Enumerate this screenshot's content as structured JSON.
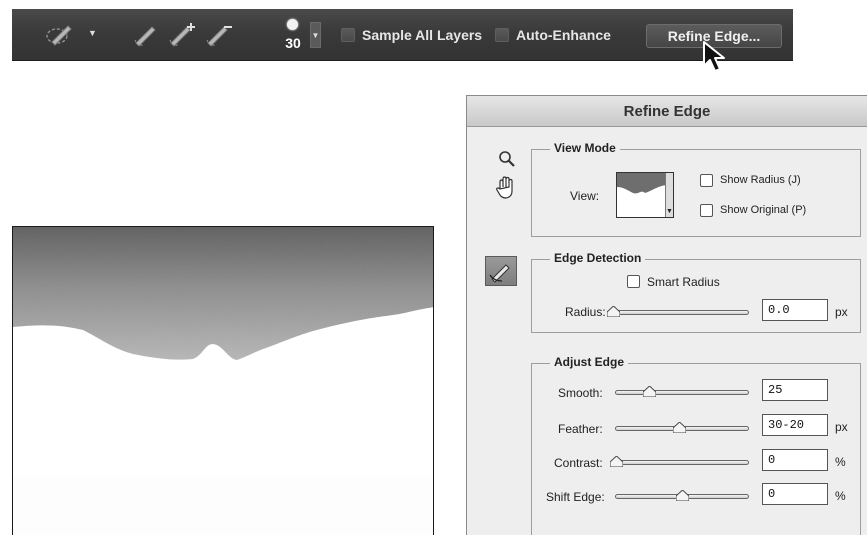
{
  "options_bar": {
    "brush_size": "30",
    "sample_all_layers_label": "Sample All Layers",
    "auto_enhance_label": "Auto-Enhance",
    "refine_edge_button": "Refine Edge..."
  },
  "dialog": {
    "title": "Refine Edge",
    "view_mode": {
      "title": "View Mode",
      "view_label": "View:",
      "show_radius_label": "Show Radius (J)",
      "show_original_label": "Show Original (P)"
    },
    "edge_detection": {
      "title": "Edge Detection",
      "smart_radius_label": "Smart Radius",
      "radius_label": "Radius:",
      "radius_value": "0.0",
      "radius_unit": "px",
      "radius_fraction": 0.0
    },
    "adjust_edge": {
      "title": "Adjust Edge",
      "smooth_label": "Smooth:",
      "smooth_value": "25",
      "smooth_fraction": 0.25,
      "feather_label": "Feather:",
      "feather_value": "30-20",
      "feather_unit": "px",
      "feather_fraction": 0.48,
      "contrast_label": "Contrast:",
      "contrast_value": "0",
      "contrast_unit": "%",
      "contrast_fraction": 0.0,
      "shift_edge_label": "Shift Edge:",
      "shift_edge_value": "0",
      "shift_edge_unit": "%",
      "shift_edge_fraction": 0.5
    }
  },
  "icons": [
    "quick-selection-icon",
    "new-selection-icon",
    "add-to-selection-icon",
    "subtract-from-selection-icon",
    "zoom-icon",
    "hand-icon",
    "refine-radius-tool-icon",
    "cursor-arrow-icon"
  ]
}
